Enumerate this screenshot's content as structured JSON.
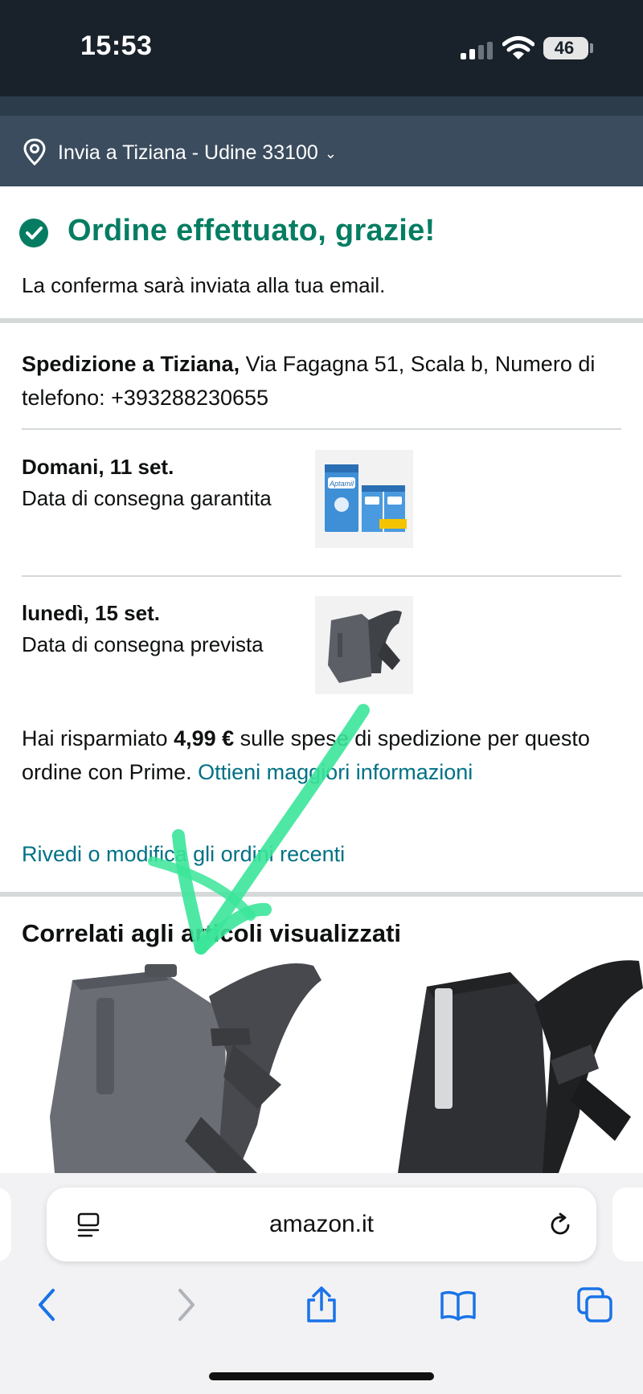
{
  "status_bar": {
    "time": "15:53",
    "battery": "46"
  },
  "location": {
    "text": "Invia a Tiziana - Udine 33100"
  },
  "confirmation": {
    "title": "Ordine effettuato, grazie!",
    "subtitle": "La conferma sarà inviata alla tua email."
  },
  "shipping": {
    "name": "Spedizione a Tiziana,",
    "address": " Via Fagagna 51, Scala b, Numero di telefono: +393288230655"
  },
  "deliveries": [
    {
      "date": "Domani, 11 set.",
      "description": "Data di consegna garantita",
      "product_label": "Aptamil"
    },
    {
      "date": "lunedì, 15 set.",
      "description": "Data di consegna prevista"
    }
  ],
  "savings": {
    "prefix": "Hai risparmiato ",
    "amount": "4,99 €",
    "suffix": " sulle spese di spedizione per questo ordine con Prime. ",
    "link": "Ottieni maggiori informazioni"
  },
  "review_link": "Rivedi o modifica gli ordini recenti",
  "related": {
    "title": "Correlati agli articoli visualizzati"
  },
  "browser": {
    "url": "amazon.it"
  },
  "colors": {
    "success": "#067d62",
    "link": "#007185",
    "header": "#3b4c5e",
    "annotation": "#3be59a"
  }
}
